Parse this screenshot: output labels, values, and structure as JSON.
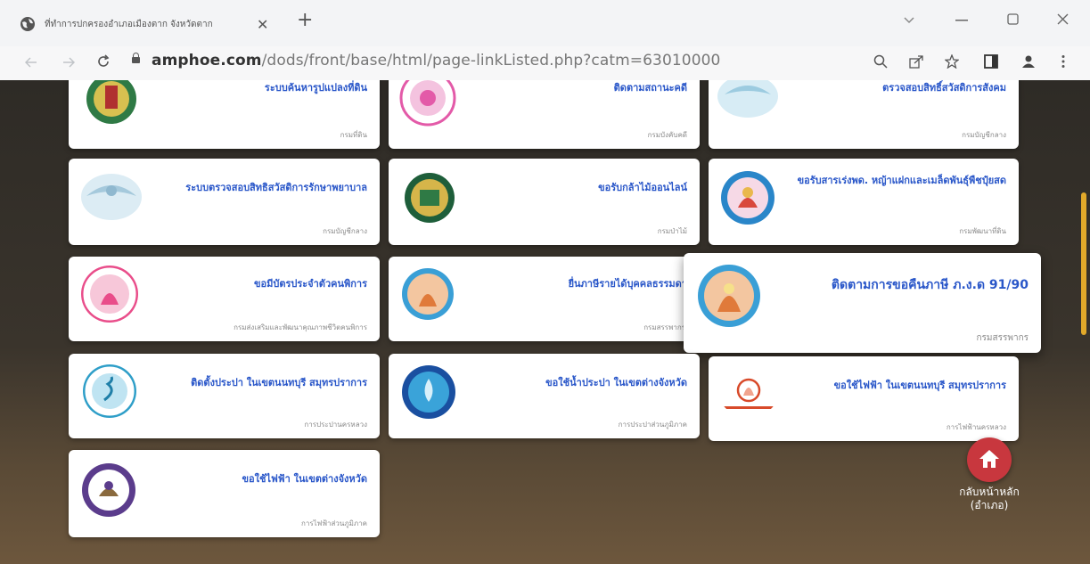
{
  "browser": {
    "tab_title": "ที่ทำการปกครองอำเภอเมืองตาก จังหวัดตาก",
    "tab_close": "✕",
    "new_tab": "+",
    "url_host": "amphoe.com",
    "url_path": "/dods/front/base/html/page-linkListed.php?catm=63010000",
    "icons": [
      "globe-icon",
      "close-icon",
      "plus-icon",
      "chevron-down-icon",
      "minimize-icon",
      "maximize-icon",
      "window-close-icon",
      "back-icon",
      "forward-icon",
      "reload-icon",
      "lock-icon",
      "zoom-icon",
      "share-icon",
      "star-icon",
      "sidebar-icon",
      "profile-icon",
      "menu-icon"
    ]
  },
  "cards": [
    {
      "title": "ระบบค้นหารูปแปลงที่ดิน",
      "agency": "กรมที่ดิน"
    },
    {
      "title": "ติดตามสถานะคดี",
      "agency": "กรมบังคับคดี"
    },
    {
      "title": "ตรวจสอบสิทธิ์สวัสดิการสังคม",
      "agency": "กรมบัญชีกลาง"
    },
    {
      "title": "ระบบตรวจสอบสิทธิสวัสดิการรักษาพยาบาล",
      "agency": "กรมบัญชีกลาง"
    },
    {
      "title": "ขอรับกล้าไม้ออนไลน์",
      "agency": "กรมป่าไม้"
    },
    {
      "title": "ขอรับสารเร่งพด. หญ้าแฝกและเมล็ดพันธุ์พืชปุ๋ยสด",
      "agency": "กรมพัฒนาที่ดิน"
    },
    {
      "title": "ขอมีบัตรประจำตัวคนพิการ",
      "agency": "กรมส่งเสริมและพัฒนาคุณภาพชีวิตคนพิการ"
    },
    {
      "title": "ยื่นภาษีรายได้บุคคลธรรมดา",
      "agency": "กรมสรรพากร"
    },
    {
      "title": "ติดตามการขอคืนภาษี ภ.ง.ด 91/90",
      "agency": "กรมสรรพากร"
    },
    {
      "title": "ติดตั้งประปา ในเขตนนทบุรี สมุทรปราการ",
      "agency": "การประปานครหลวง"
    },
    {
      "title": "ขอใช้น้ำประปา ในเขตต่างจังหวัด",
      "agency": "การประปาส่วนภูมิภาค"
    },
    {
      "title": "ขอใช้ไฟฟ้า ในเขตนนทบุรี สมุทรปราการ",
      "agency": "การไฟฟ้านครหลวง"
    },
    {
      "title": "ขอใช้ไฟฟ้า ในเขตต่างจังหวัด",
      "agency": "การไฟฟ้าส่วนภูมิภาค"
    }
  ],
  "home": {
    "label_line1": "กลับหน้าหลัก",
    "label_line2": "(อำเภอ)"
  },
  "colors": {
    "title": "#2a57c9",
    "home_button": "#c8373e",
    "scrollbar": "#e2a92a"
  }
}
